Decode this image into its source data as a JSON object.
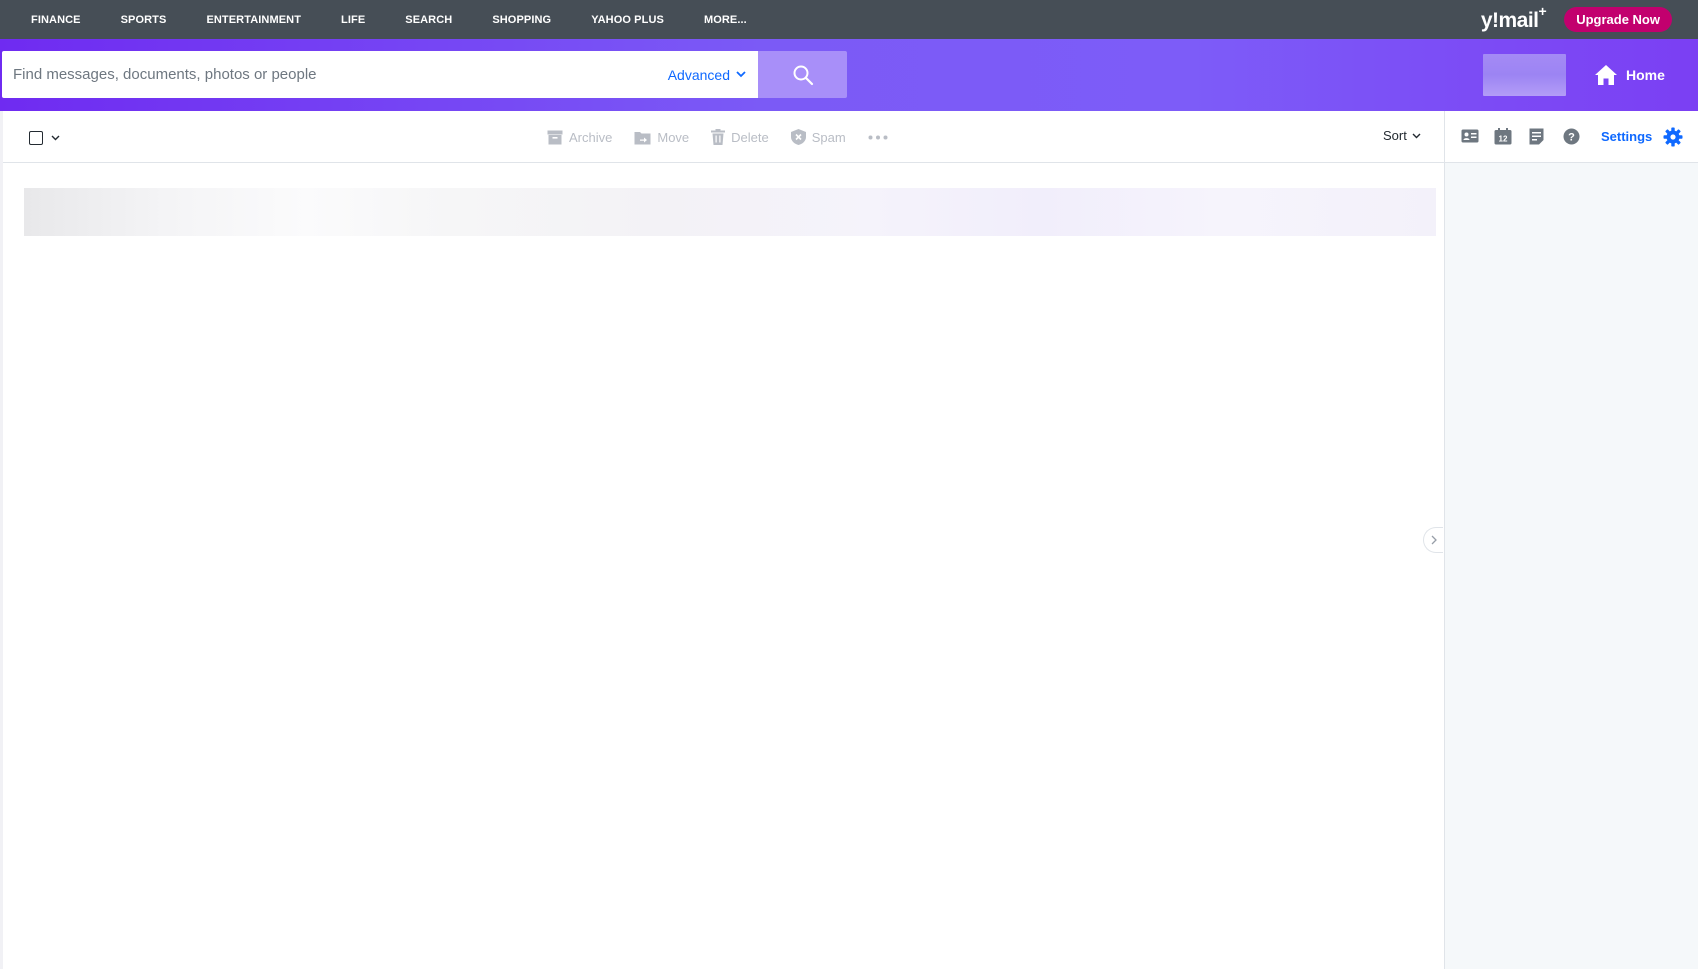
{
  "topnav": {
    "links": [
      "FINANCE",
      "SPORTS",
      "ENTERTAINMENT",
      "LIFE",
      "SEARCH",
      "SHOPPING",
      "YAHOO PLUS",
      "MORE..."
    ],
    "brand": "y!mail",
    "brand_plus": "+",
    "upgrade_label": "Upgrade Now"
  },
  "search": {
    "placeholder": "Find messages, documents, photos or people",
    "advanced_label": "Advanced"
  },
  "header": {
    "home_label": "Home"
  },
  "toolbar": {
    "actions": [
      "Archive",
      "Move",
      "Delete",
      "Spam"
    ],
    "sort_label": "Sort"
  },
  "right_panel": {
    "settings_label": "Settings"
  },
  "icons": {
    "search": "search-icon",
    "home": "home-icon",
    "contacts": "contacts-icon",
    "calendar": "calendar-icon",
    "calendar_day": "12",
    "notepad": "notepad-icon",
    "help": "help-icon",
    "settings": "gear-icon"
  },
  "colors": {
    "topnav_bg": "#464e56",
    "header_gradient_start": "#6f2bf1",
    "upgrade_bg": "#c2006e",
    "link_blue": "#0f69ff",
    "disabled_action": "#b9bdc5"
  }
}
